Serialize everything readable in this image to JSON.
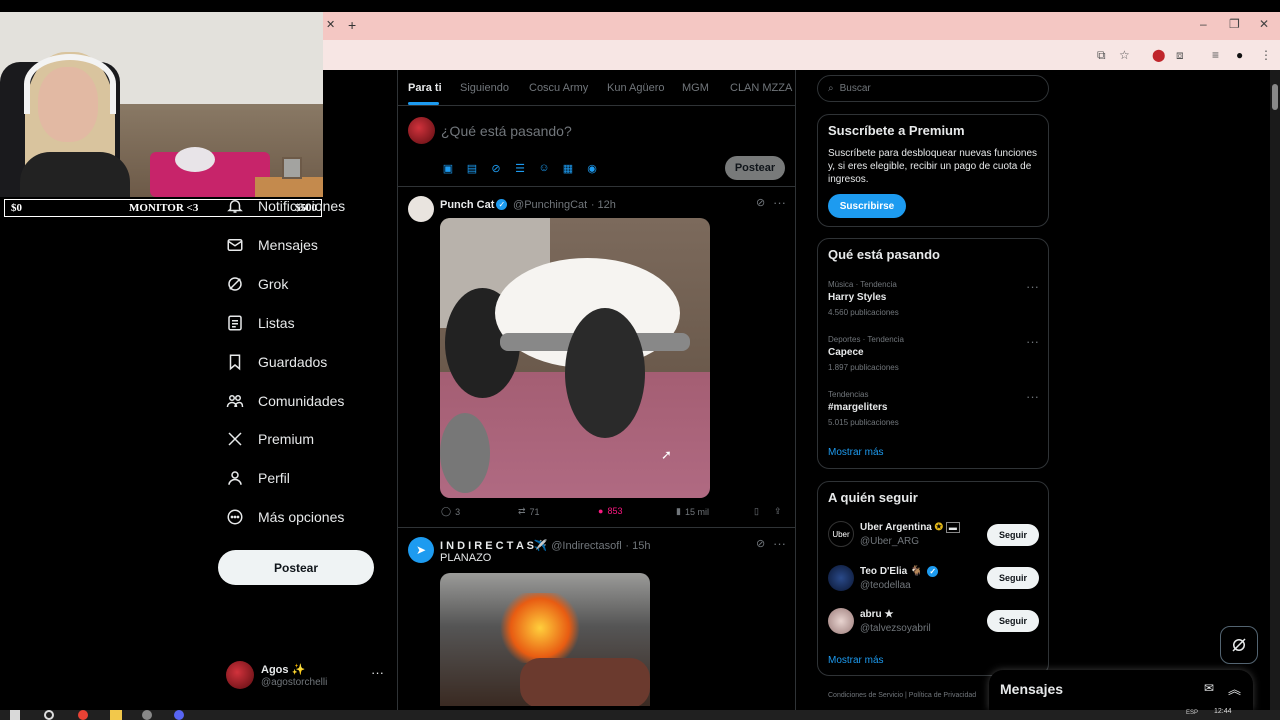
{
  "webcam": {
    "left_amount": "$0",
    "center_label": "MONITOR <3",
    "right_amount": "$500"
  },
  "nav": {
    "items": [
      {
        "label": "Notificaciones",
        "icon": "bell-icon"
      },
      {
        "label": "Mensajes",
        "icon": "mail-icon"
      },
      {
        "label": "Grok",
        "icon": "grok-icon"
      },
      {
        "label": "Listas",
        "icon": "list-icon"
      },
      {
        "label": "Guardados",
        "icon": "bookmark-icon"
      },
      {
        "label": "Comunidades",
        "icon": "communities-icon"
      },
      {
        "label": "Premium",
        "icon": "x-logo-icon"
      },
      {
        "label": "Perfil",
        "icon": "person-icon"
      },
      {
        "label": "Más opciones",
        "icon": "more-circle-icon"
      }
    ],
    "post_label": "Postear",
    "me": {
      "name": "Agos ✨",
      "handle": "@agostorchelli"
    }
  },
  "feed": {
    "tabs": [
      "Para ti",
      "Siguiendo",
      "Coscu Army",
      "Kun Agüero",
      "MGM",
      "CLAN MZZA"
    ],
    "active_tab": "Para ti",
    "compose_placeholder": "¿Qué está pasando?",
    "compose_post_label": "Postear",
    "tweets": [
      {
        "name": "Punch Cat",
        "handle": "@PunchingCat",
        "time": "· 12h",
        "text": "",
        "replies": "3",
        "retweets": "71",
        "likes": "853",
        "views": "15 mil"
      },
      {
        "name": "I N D I R E C T A S✈️",
        "handle": "@Indirectasofl",
        "time": "· 15h",
        "text": "PLANAZO"
      }
    ]
  },
  "sidebar": {
    "search_placeholder": "Buscar",
    "premium": {
      "title": "Suscríbete a Premium",
      "body": "Suscríbete para desbloquear nuevas funciones y, si eres elegible, recibir un pago de cuota de ingresos.",
      "button": "Suscribirse"
    },
    "trends": {
      "title": "Qué está pasando",
      "items": [
        {
          "category": "Música · Tendencia",
          "name": "Harry Styles",
          "count": "4.560 publicaciones"
        },
        {
          "category": "Deportes · Tendencia",
          "name": "Capece",
          "count": "1.897 publicaciones"
        },
        {
          "category": "Tendencias",
          "name": "#margeliters",
          "count": "5.015 publicaciones"
        }
      ],
      "show_more": "Mostrar más"
    },
    "who_to_follow": {
      "title": "A quién seguir",
      "items": [
        {
          "name": "Uber Argentina",
          "handle": "@Uber_ARG",
          "button": "Seguir"
        },
        {
          "name": "Teo D'Elia 🐐",
          "handle": "@teodellaa",
          "button": "Seguir"
        },
        {
          "name": "abru ★",
          "handle": "@talvezsoyabril",
          "button": "Seguir"
        }
      ],
      "show_more": "Mostrar más"
    },
    "footer": "Condiciones de Servicio  |  Política de Privacidad"
  },
  "messages": {
    "title": "Mensajes"
  },
  "taskbar": {
    "clock": "12:44",
    "lang": "ESP"
  },
  "colors": {
    "accent": "#1d9bf0",
    "background": "#000000",
    "border": "#2f3336",
    "tab_bar": "#f4c7c3"
  }
}
